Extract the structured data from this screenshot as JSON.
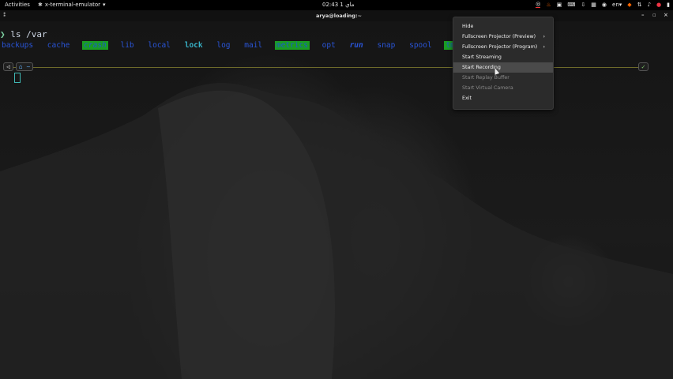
{
  "topbar": {
    "activities": "Activities",
    "app_name": "x-terminal-emulator",
    "app_chevron": "▾",
    "clock": "02:43  1 ماي",
    "lang": "en",
    "tray_icons": [
      "obs-icon",
      "flame-icon",
      "square-icon",
      "keyboard-icon",
      "download-icon",
      "grid-icon",
      "ubuntu-icon",
      "brave-icon",
      "network-icon",
      "speaker-icon",
      "mic-icon",
      "battery-icon"
    ]
  },
  "window": {
    "title": "arya@loading:~",
    "close_glyph": "×",
    "max_glyph": "▫",
    "min_glyph": "–"
  },
  "terminal": {
    "prompt_arrow": "❯",
    "command": "ls /var",
    "listing": [
      "backups",
      "cache",
      "crash",
      "lib",
      "local",
      "lock",
      "log",
      "mail",
      "metrics",
      "opt",
      "run",
      "snap",
      "spool",
      "tmp"
    ],
    "prompt_seg1": "◁",
    "prompt_dir": "~",
    "prompt_home_icon": "⌂",
    "status_check": "✓"
  },
  "tray_menu": {
    "items": [
      {
        "label": "Hide",
        "submenu": false,
        "state": "normal"
      },
      {
        "label": "Fullscreen Projector (Preview)",
        "submenu": true,
        "state": "normal"
      },
      {
        "label": "Fullscreen Projector (Program)",
        "submenu": true,
        "state": "normal"
      },
      {
        "label": "Start Streaming",
        "submenu": false,
        "state": "normal"
      },
      {
        "label": "Start Recording",
        "submenu": false,
        "state": "hover"
      },
      {
        "label": "Start Replay Buffer",
        "submenu": false,
        "state": "disabled"
      },
      {
        "label": "Start Virtual Camera",
        "submenu": false,
        "state": "disabled"
      },
      {
        "label": "Exit",
        "submenu": false,
        "state": "normal"
      }
    ],
    "submenu_glyph": "›"
  },
  "colors": {
    "accent_green": "#1a9c22",
    "dir_blue": "#2a55d8",
    "menu_bg": "#2b2b2b",
    "menu_hover": "#4a4a4a"
  }
}
